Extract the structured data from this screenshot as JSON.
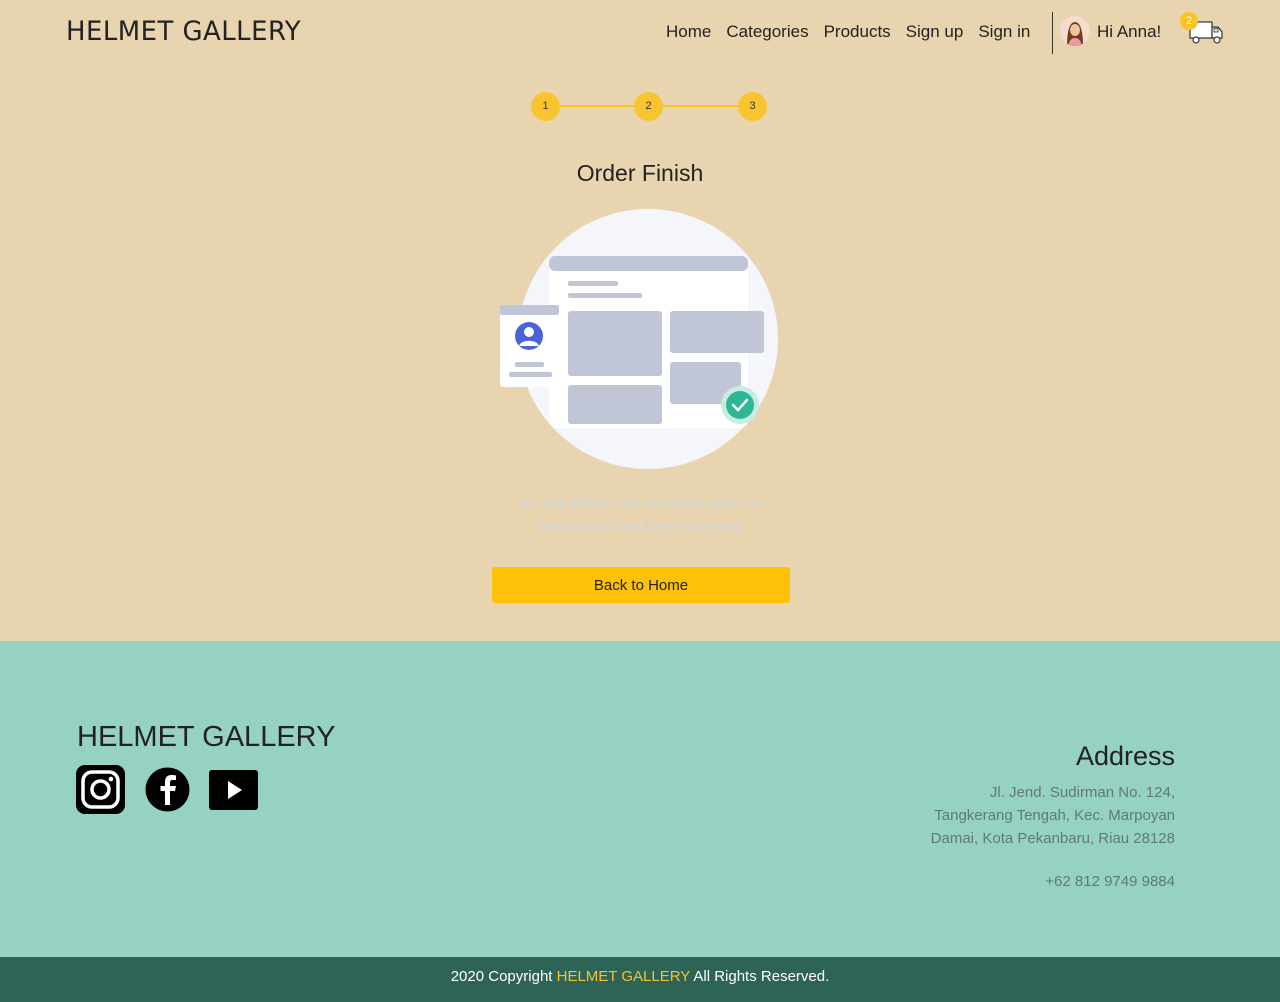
{
  "header": {
    "brand": "HELMET GALLERY",
    "nav": [
      "Home",
      "Categories",
      "Products",
      "Sign up",
      "Sign in"
    ],
    "greeting": "Hi Anna!",
    "cart_count": "2"
  },
  "stepper": {
    "steps": [
      "1",
      "2",
      "3"
    ]
  },
  "main": {
    "title": "Order Finish",
    "info_line1": "We will inform you via email once the",
    "info_line2": "transaction has been accepted",
    "back_button": "Back to Home"
  },
  "footer": {
    "brand": "HELMET GALLERY",
    "social": [
      "instagram-icon",
      "facebook-icon",
      "youtube-icon"
    ],
    "address_heading": "Address",
    "address_lines": [
      "Jl. Jend. Sudirman No. 124,",
      "Tangkerang Tengah, Kec. Marpoyan",
      "Damai, Kota Pekanbaru, Riau 28128"
    ],
    "phone": "+62 812 9749 9884",
    "copyright_prefix": "2020 Copyright",
    "copyright_brand": "HELMET GALLERY",
    "copyright_suffix": "All Rights Reserved."
  },
  "colors": {
    "page_bg": "#e8d5b0",
    "accent": "#ffc107",
    "footer_bg": "#95d2c3",
    "copyright_bg": "#2e6456"
  }
}
